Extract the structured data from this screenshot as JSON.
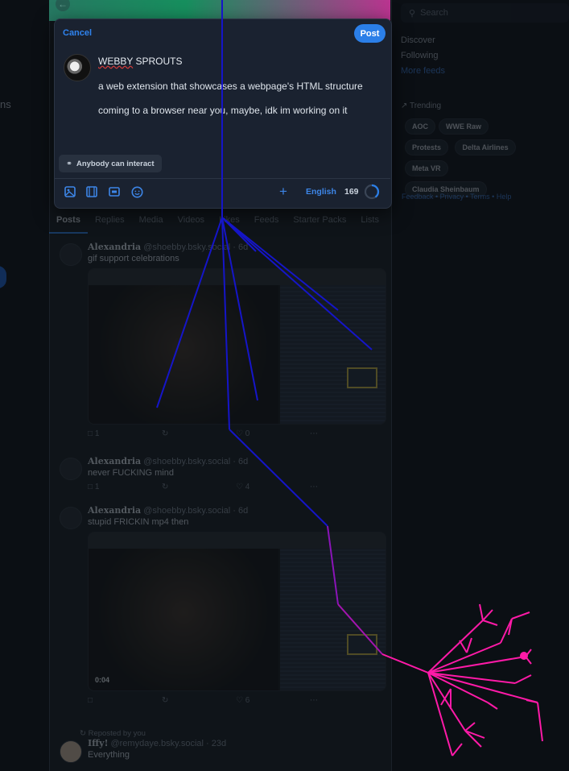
{
  "left": {
    "fragment": "ns"
  },
  "composer": {
    "cancel_label": "Cancel",
    "post_label": "Post",
    "title": "WEBBY",
    "title_rest": " SPROUTS",
    "line1": "a web extension that showcases a webpage's HTML structure",
    "line2": "coming to a browser near you, maybe, idk im working on it",
    "interaction_label": "Anybody can interact",
    "language": "English",
    "char_count": "169",
    "tools": [
      "image-icon",
      "video-icon",
      "gif-icon",
      "emoji-icon"
    ]
  },
  "profile_tabs": [
    "Posts",
    "Replies",
    "Media",
    "Videos",
    "Likes",
    "Feeds",
    "Starter Packs",
    "Lists"
  ],
  "posts": [
    {
      "author": "Alexandria",
      "handle": "@shoebby.bsky.social",
      "age": "6d",
      "text": "gif support celebrations",
      "replies": "1",
      "likes": "0"
    },
    {
      "author": "Alexandria",
      "handle": "@shoebby.bsky.social",
      "age": "6d",
      "text": "never FUCKING mind",
      "replies": "1",
      "likes": "4"
    },
    {
      "author": "Alexandria",
      "handle": "@shoebby.bsky.social",
      "age": "6d",
      "text": "stupid FRICKIN mp4 then",
      "replies": "",
      "likes": "6",
      "duration": "0:04"
    },
    {
      "repost_label": "Reposted by you",
      "author": "Iffy!",
      "handle": "@remydaye.bsky.social",
      "age": "23d",
      "text": "Everything"
    }
  ],
  "sidebar": {
    "search_placeholder": "Search",
    "links": [
      "Discover",
      "Following",
      "More feeds"
    ],
    "trending_title": "Trending",
    "trending": [
      "AOC",
      "WWE Raw",
      "Protests",
      "Delta Airlines",
      "Meta VR",
      "Claudia Sheinbaum"
    ],
    "footer": "Feedback • Privacy • Terms • Help"
  },
  "colors": {
    "accent": "#2b7fe8",
    "tree_blue": "#1515c8",
    "tree_pink": "#ff1aa8"
  }
}
